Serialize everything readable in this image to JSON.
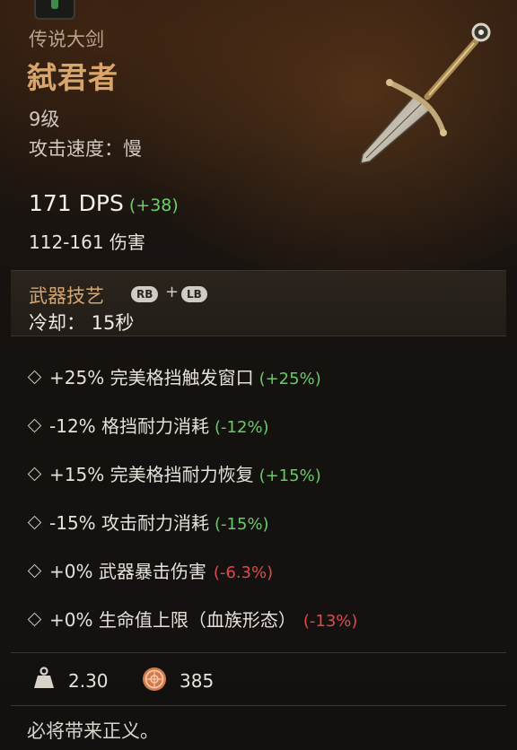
{
  "item": {
    "type": "传说大剑",
    "name": "弑君者",
    "level": "9级",
    "attack_speed": "攻击速度：慢",
    "dps": "171 DPS",
    "dps_delta": "(+38)",
    "damage": "112-161 伤害"
  },
  "weapon_art": {
    "title": "武器技艺",
    "button_1": "RB",
    "plus": "+",
    "button_2": "LB",
    "cooldown": "冷却：  15秒"
  },
  "stats": [
    {
      "text": "+25% 完美格挡触发窗口",
      "delta": "(+25%)",
      "delta_kind": "positive"
    },
    {
      "text": "-12% 格挡耐力消耗",
      "delta": "(-12%)",
      "delta_kind": "positive"
    },
    {
      "text": "+15% 完美格挡耐力恢复",
      "delta": "(+15%)",
      "delta_kind": "positive"
    },
    {
      "text": "-15% 攻击耐力消耗",
      "delta": "(-15%)",
      "delta_kind": "positive"
    },
    {
      "text": "+0% 武器暴击伤害",
      "delta": "(-6.3%)",
      "delta_kind": "negative"
    },
    {
      "text": "+0% 生命值上限（血族形态）",
      "delta": "(-13%)",
      "delta_kind": "negative"
    }
  ],
  "footer": {
    "weight": "2.30",
    "value": "385",
    "flavor_text": "必将带来正义。"
  },
  "colors": {
    "positive": "#67cc67",
    "negative": "#e04a4a",
    "name": "#d9a56a"
  },
  "icons": {
    "badge": "weapon-slot-badge-icon",
    "sword": "greatsword-icon",
    "weight": "weight-icon",
    "currency": "coin-icon",
    "bullet": "diamond-icon"
  }
}
